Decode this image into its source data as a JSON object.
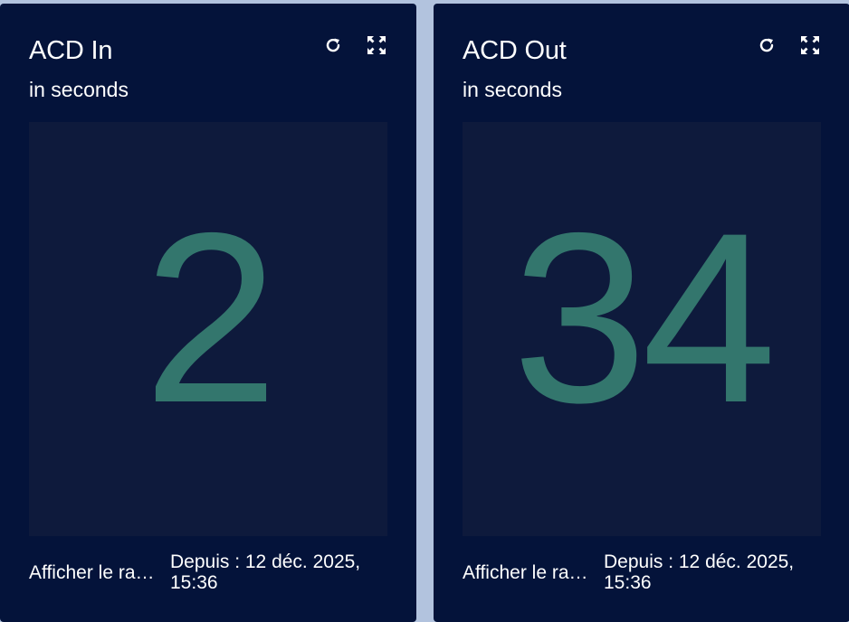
{
  "colors": {
    "card_bg": "#04133a",
    "kpi_area_bg": "#0e1a3c",
    "value_color": "#33766d",
    "page_bg": "#b2c3de"
  },
  "cards": [
    {
      "title": "ACD In",
      "subtitle": "in seconds",
      "value": "2",
      "footer_link": "Afficher le rapport",
      "since_label": "Depuis : 12 déc. 2025,",
      "since_time": "15:36",
      "icons": [
        "refresh-icon",
        "expand-icon"
      ]
    },
    {
      "title": "ACD Out",
      "subtitle": "in seconds",
      "value": "34",
      "footer_link": "Afficher le rapport",
      "since_label": "Depuis : 12 déc. 2025,",
      "since_time": "15:36",
      "icons": [
        "refresh-icon",
        "expand-icon"
      ]
    }
  ]
}
